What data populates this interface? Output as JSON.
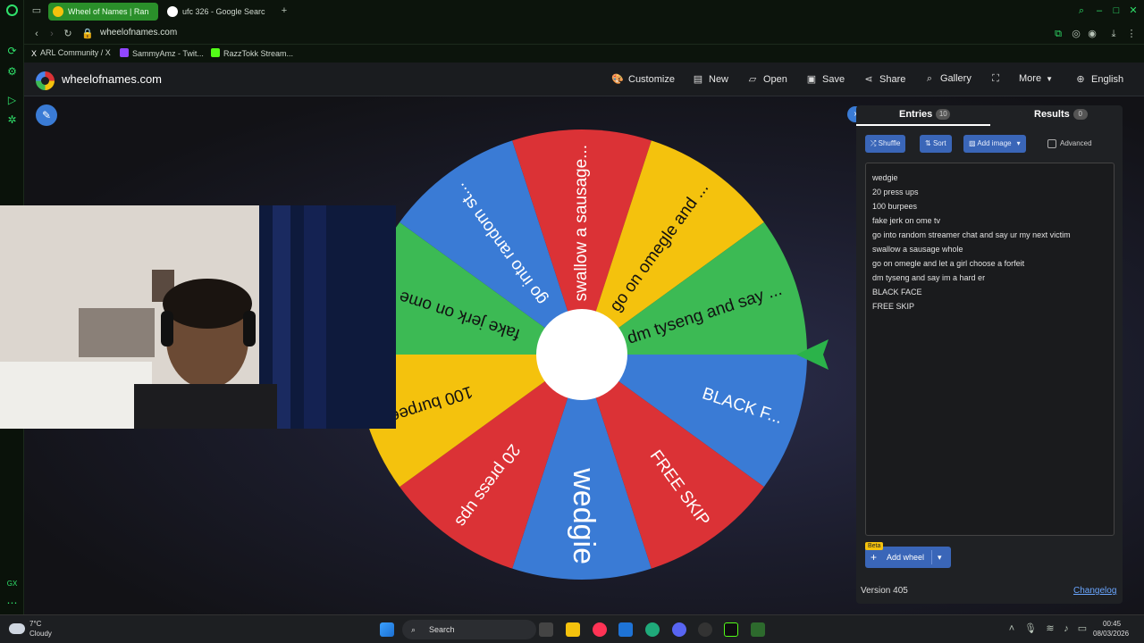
{
  "browser": {
    "tabs": [
      {
        "title": "Wheel of Names | Ran",
        "active": true
      },
      {
        "title": "ufc 326 - Google Search",
        "active": false
      }
    ],
    "url": "wheelofnames.com",
    "bookmarks": [
      "ARL Community / X",
      "SammyAmz - Twit...",
      "RazzTokk Stream..."
    ],
    "sidebar_bottom_label": "GX"
  },
  "site": {
    "title": "wheelofnames.com",
    "menu": [
      "Customize",
      "New",
      "Open",
      "Save",
      "Share",
      "Gallery",
      "More",
      "English"
    ]
  },
  "wheel": {
    "segment_colors": [
      "#3a7bd5",
      "#db3236",
      "#f4c20d",
      "#3cba54"
    ],
    "pointer_color": "#2bb34a",
    "segments": [
      "wedgie",
      "20 press ups",
      "100 burpees",
      "fake jerk on ome ...",
      "go into random st...",
      "swallow a sausage...",
      "go on omegle and ...",
      "dm tyseng and say ...",
      "BLACK F...",
      "FREE SKIP"
    ]
  },
  "panel": {
    "entries_tab": "Entries",
    "entries_count": "10",
    "results_tab": "Results",
    "results_count": "0",
    "buttons": {
      "shuffle": "Shuffle",
      "sort": "Sort",
      "add_image": "Add image"
    },
    "advanced_label": "Advanced",
    "entries": [
      "wedgie",
      "20 press ups",
      "100 burpees",
      "fake jerk on ome tv",
      "go into random streamer chat and say ur my next victim",
      "swallow a sausage whole",
      "go on omegle and let a girl choose a forfeit",
      "dm tyseng and say im a hard er",
      "BLACK FACE",
      "FREE SKIP"
    ],
    "beta_label": "Beta",
    "add_wheel_label": "Add wheel",
    "version": "Version 405",
    "changelog": "Changelog"
  },
  "taskbar": {
    "weather_temp": "7°C",
    "weather_desc": "Cloudy",
    "search_placeholder": "Search",
    "time": "00:45",
    "date": "08/03/2026"
  }
}
